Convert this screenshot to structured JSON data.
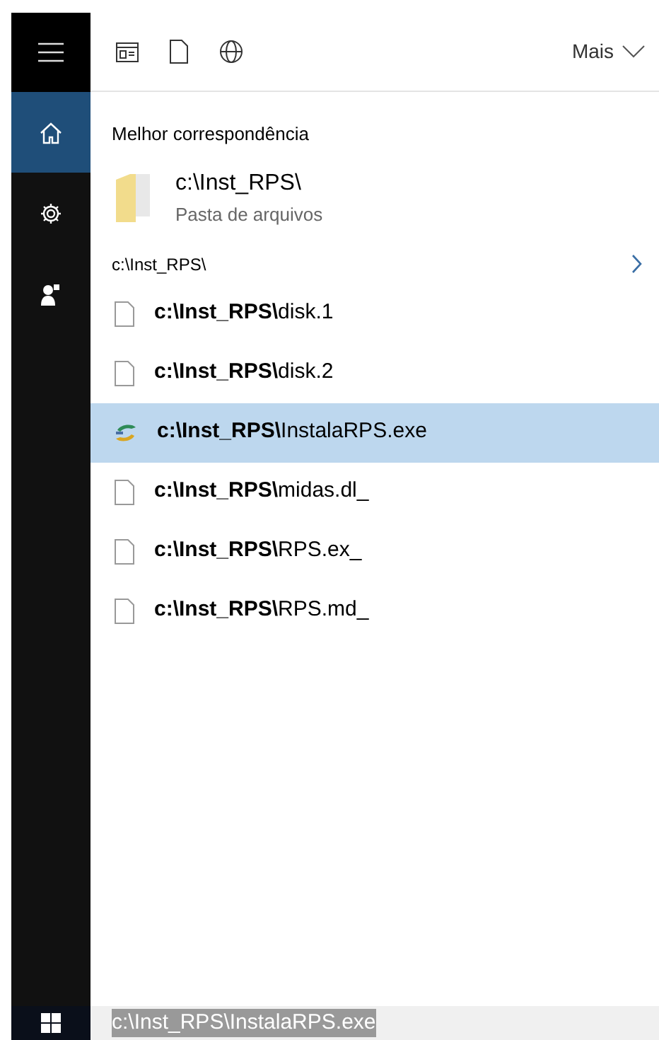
{
  "sidebar": {
    "items": [
      {
        "kind": "menu",
        "selected": false
      },
      {
        "kind": "home",
        "selected": true
      },
      {
        "kind": "settings",
        "selected": false
      },
      {
        "kind": "person",
        "selected": false
      }
    ]
  },
  "toolbar": {
    "more": "Mais"
  },
  "best_match": {
    "heading": "Melhor correspondência",
    "title": "c:\\Inst_RPS\\",
    "subtitle": "Pasta de arquivos"
  },
  "section": {
    "heading": "c:\\Inst_RPS\\"
  },
  "results": [
    {
      "prefix": "c:\\Inst_RPS\\",
      "name": "disk.1",
      "kind": "file",
      "selected": false
    },
    {
      "prefix": "c:\\Inst_RPS\\",
      "name": "disk.2",
      "kind": "file",
      "selected": false
    },
    {
      "prefix": "c:\\Inst_RPS\\",
      "name": "InstalaRPS.exe",
      "kind": "app",
      "selected": true
    },
    {
      "prefix": "c:\\Inst_RPS\\",
      "name": "midas.dl_",
      "kind": "file",
      "selected": false
    },
    {
      "prefix": "c:\\Inst_RPS\\",
      "name": "RPS.ex_",
      "kind": "file",
      "selected": false
    },
    {
      "prefix": "c:\\Inst_RPS\\",
      "name": "RPS.md_",
      "kind": "file",
      "selected": false
    }
  ],
  "search": {
    "value": "c:\\Inst_RPS\\InstalaRPS.exe"
  }
}
